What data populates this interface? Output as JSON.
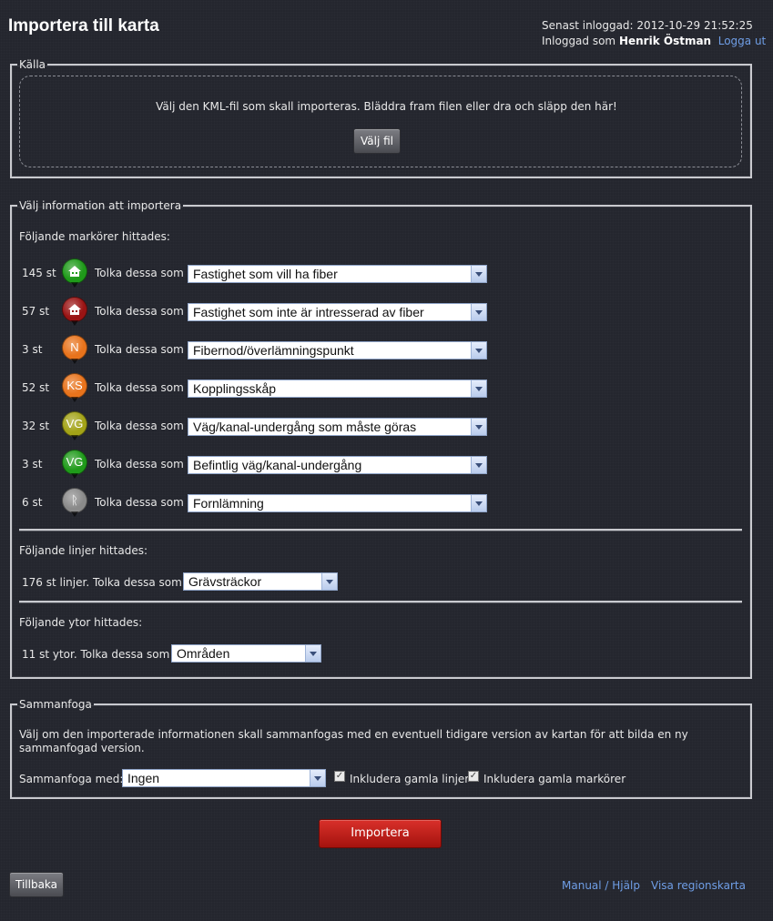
{
  "header": {
    "title": "Importera till karta",
    "last_login_label": "Senast inloggad:",
    "last_login_value": "2012-10-29 21:52:25",
    "logged_in_as_label": "Inloggad som",
    "user_name": "Henrik Östman",
    "logout_link": "Logga ut"
  },
  "source": {
    "legend": "Källa",
    "instructions": "Välj den KML-fil som skall importeras. Bläddra fram filen eller dra och släpp den här!",
    "choose_file_button": "Välj fil"
  },
  "import_info": {
    "legend": "Välj information att importera",
    "markers_heading": "Följande markörer hittades:",
    "interpret_label": "Tolka dessa som",
    "markers": [
      {
        "count": "145 st",
        "icon": "house-icon",
        "pin_label": "",
        "pin_color": "#1f9a1a",
        "type": "Fastighet som vill ha fiber"
      },
      {
        "count": "57 st",
        "icon": "house-icon",
        "pin_label": "",
        "pin_color": "#9a1414",
        "type": "Fastighet som inte är intresserad av fiber"
      },
      {
        "count": "3 st",
        "icon": "node-icon",
        "pin_label": "N",
        "pin_color": "#e8731c",
        "type": "Fibernod/överlämningspunkt"
      },
      {
        "count": "52 st",
        "icon": "cabinet-icon",
        "pin_label": "KS",
        "pin_color": "#e8731c",
        "type": "Kopplingsskåp"
      },
      {
        "count": "32 st",
        "icon": "crossing-icon",
        "pin_label": "VG",
        "pin_color": "#a3a317",
        "type": "Väg/kanal-undergång som måste göras"
      },
      {
        "count": "3 st",
        "icon": "crossing-icon",
        "pin_label": "VG",
        "pin_color": "#1f9a1a",
        "type": "Befintlig väg/kanal-undergång"
      },
      {
        "count": "6 st",
        "icon": "relic-icon",
        "pin_label": "ᚱ",
        "pin_color": "#8a8a8a",
        "type": "Fornlämning"
      }
    ],
    "lines_heading": "Följande linjer hittades:",
    "lines_text": "176 st linjer. Tolka dessa som",
    "lines_value": "Grävsträckor",
    "areas_heading": "Följande ytor hittades:",
    "areas_text": "11 st ytor. Tolka dessa som",
    "areas_value": "Områden"
  },
  "merge": {
    "legend": "Sammanfoga",
    "description": "Välj om den importerade informationen skall sammanfogas med en eventuell tidigare version av kartan för att bilda en ny sammanfogad version.",
    "merge_with_label": "Sammanfoga med:",
    "merge_with_value": "Ingen",
    "include_lines_label": "Inkludera gamla linjer",
    "include_lines_checked": true,
    "include_markers_label": "Inkludera gamla markörer",
    "include_markers_checked": true
  },
  "actions": {
    "import_button": "Importera",
    "back_button": "Tillbaka",
    "help_link": "Manual / Hjälp",
    "region_map_link": "Visa regionskarta"
  },
  "colors": {
    "background": "#24262e",
    "link": "#6f9ee6",
    "import_button": "#c21f19"
  }
}
